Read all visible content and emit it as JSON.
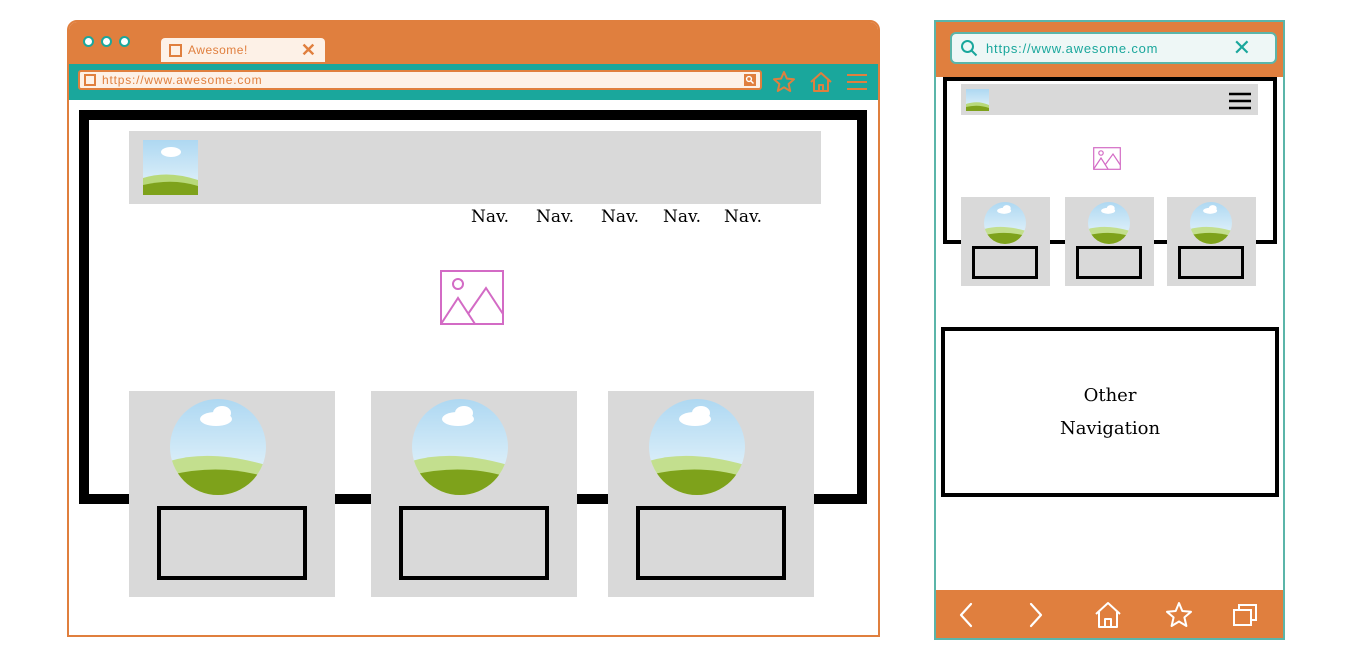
{
  "desktop": {
    "tab": {
      "title": "Awesome!",
      "close_icon": "close-icon"
    },
    "address_bar": {
      "url": "https://www.awesome.com",
      "search_icon": "search-icon"
    },
    "toolbar_icons": [
      "star-icon",
      "home-icon",
      "menu-icon"
    ],
    "nav_links": [
      "Nav.",
      "Nav.",
      "Nav.",
      "Nav.",
      "Nav."
    ],
    "cards": 3
  },
  "mobile": {
    "address_bar": {
      "url": "https://www.awesome.com",
      "search_icon": "search-icon",
      "close_icon": "close-icon"
    },
    "other_navigation": {
      "line1": "Other",
      "line2": "Navigation"
    },
    "bottom_bar_icons": [
      "back-icon",
      "forward-icon",
      "home-icon",
      "star-icon",
      "tabs-icon"
    ]
  },
  "colors": {
    "orange": "#e07f3e",
    "teal": "#1aa79c",
    "placeholder_gray": "#d9d9d9",
    "image_placeholder_pink": "#d36bc5"
  }
}
